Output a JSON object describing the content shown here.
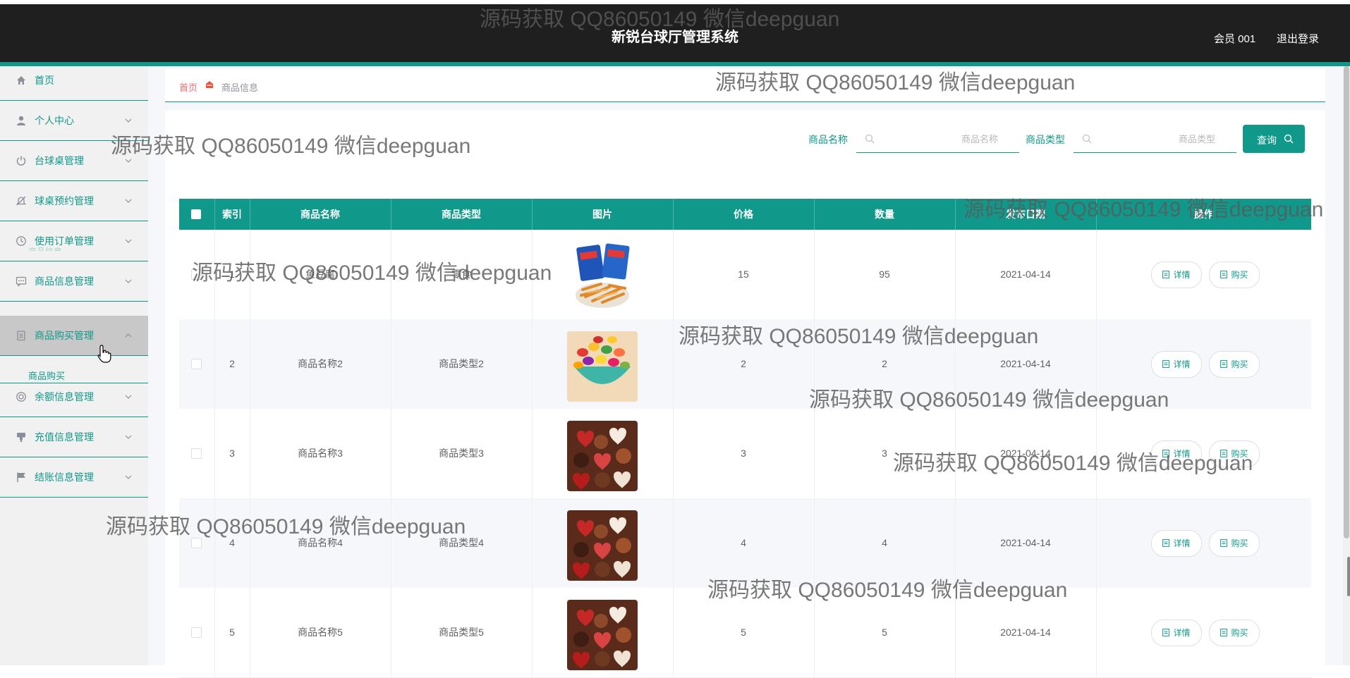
{
  "header": {
    "title": "新锐台球厅管理系统",
    "user": "会员 001",
    "logout": "退出登录"
  },
  "sidebar": {
    "items": [
      {
        "label": "首页",
        "icon": "home-icon"
      },
      {
        "label": "个人中心",
        "icon": "user-icon"
      },
      {
        "label": "台球桌管理",
        "icon": "power-icon"
      },
      {
        "label": "球桌预约管理",
        "icon": "bell-off-icon"
      },
      {
        "label": "使用订单管理",
        "icon": "clock-icon"
      },
      {
        "label": "商品信息管理",
        "icon": "chat-icon"
      },
      {
        "label": "商品购买管理",
        "icon": "document-icon"
      },
      {
        "label": "余额信息管理",
        "icon": "coin-icon"
      },
      {
        "label": "充值信息管理",
        "icon": "stamp-icon"
      },
      {
        "label": "结账信息管理",
        "icon": "flag-icon"
      }
    ],
    "sub_item": "商品购买",
    "accent": "#10998a"
  },
  "breadcrumb": {
    "home": "首页",
    "current": "商品信息"
  },
  "search": {
    "name_label": "商品名称",
    "name_placeholder": "商品名称",
    "type_label": "商品类型",
    "type_placeholder": "商品类型",
    "button": "查询"
  },
  "table": {
    "headers": [
      "索引",
      "商品名称",
      "商品类型",
      "图片",
      "价格",
      "数量",
      "发布日期",
      "操作"
    ],
    "detail_label": "详情",
    "buy_label": "购买",
    "rows": [
      {
        "index": "1",
        "name": "鱼豆腐",
        "type": "零食",
        "image": "snack-bags",
        "price": "15",
        "qty": "95",
        "date": "2021-04-14"
      },
      {
        "index": "2",
        "name": "商品名称2",
        "type": "商品类型2",
        "image": "candy-bowl",
        "price": "2",
        "qty": "2",
        "date": "2021-04-14"
      },
      {
        "index": "3",
        "name": "商品名称3",
        "type": "商品类型3",
        "image": "chocolates",
        "price": "3",
        "qty": "3",
        "date": "2021-04-14"
      },
      {
        "index": "4",
        "name": "商品名称4",
        "type": "商品类型4",
        "image": "chocolates",
        "price": "4",
        "qty": "4",
        "date": "2021-04-14"
      },
      {
        "index": "5",
        "name": "商品名称5",
        "type": "商品类型5",
        "image": "chocolates",
        "price": "5",
        "qty": "5",
        "date": "2021-04-14"
      }
    ]
  },
  "watermark": "源码获取 QQ86050149 微信deepguan"
}
